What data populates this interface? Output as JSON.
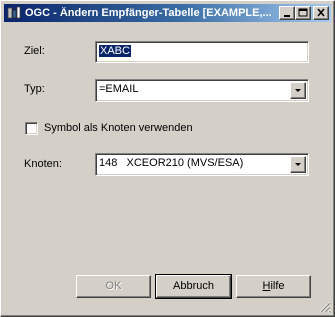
{
  "window": {
    "title": "OGC - Ändern Empfänger-Tabelle [EXAMPLE,...",
    "icon": "app-icon",
    "controls": {
      "minimize": "minimize-icon",
      "maximize": "maximize-icon",
      "close": "close-icon"
    }
  },
  "form": {
    "ziel": {
      "label": "Ziel:",
      "value": "XABC"
    },
    "typ": {
      "label": "Typ:",
      "value": "=EMAIL"
    },
    "symbol_checkbox": {
      "label": "Symbol als Knoten verwenden",
      "checked": false
    },
    "knoten": {
      "label": "Knoten:",
      "value": "148   XCEOR210 (MVS/ESA)"
    }
  },
  "buttons": {
    "ok": "OK",
    "abbruch": "Abbruch",
    "hilfe": "Hilfe"
  },
  "colors": {
    "face": "#d4d0c8",
    "title_start": "#0a246a",
    "title_end": "#a6caf0",
    "selection": "#0a246a"
  }
}
